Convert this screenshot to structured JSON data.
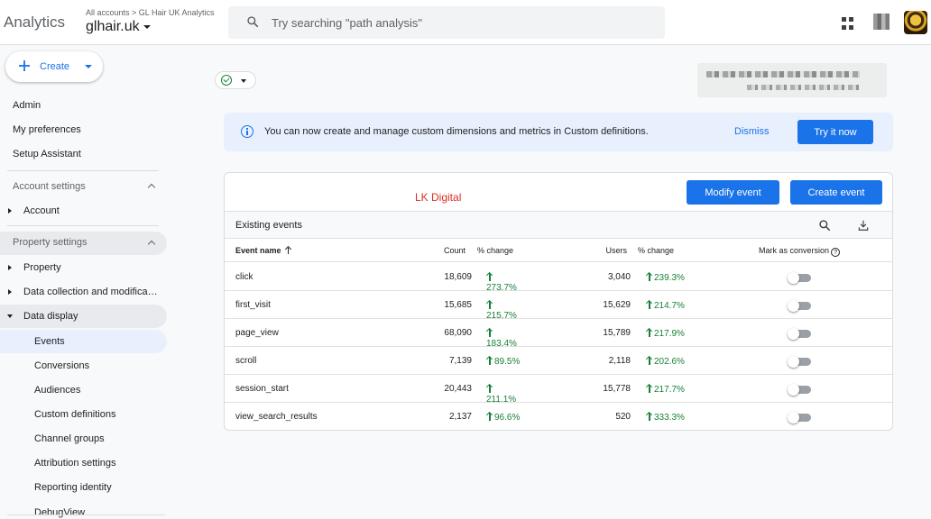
{
  "header": {
    "app_name": "Analytics",
    "breadcrumb": "All accounts > GL Hair UK Analytics",
    "property": "glhair.uk",
    "search_placeholder": "Try searching \"path analysis\""
  },
  "sidebar": {
    "create_label": "Create",
    "top_items": [
      "Admin",
      "My preferences",
      "Setup Assistant"
    ],
    "account_settings": {
      "title": "Account settings",
      "items": [
        "Account"
      ]
    },
    "property_settings": {
      "title": "Property settings",
      "items": [
        "Property",
        "Data collection and modifica…",
        "Data display"
      ],
      "data_display_items": [
        "Events",
        "Conversions",
        "Audiences",
        "Custom definitions",
        "Channel groups",
        "Attribution settings",
        "Reporting identity",
        "DebugView"
      ],
      "active_item": "Events"
    }
  },
  "banner": {
    "message": "You can now create and manage custom dimensions and metrics in Custom definitions.",
    "dismiss_label": "Dismiss",
    "try_label": "Try it now"
  },
  "events_card": {
    "org_label": "LK Digital",
    "modify_label": "Modify event",
    "create_label": "Create event",
    "title": "Existing events",
    "columns": {
      "event_name": "Event name",
      "count": "Count",
      "count_change": "% change",
      "users": "Users",
      "users_change": "% change",
      "conversion": "Mark as conversion"
    },
    "rows": [
      {
        "name": "click",
        "count": "18,609",
        "count_change": "273.7%",
        "users": "3,040",
        "users_change": "239.3%",
        "is_conversion": false
      },
      {
        "name": "first_visit",
        "count": "15,685",
        "count_change": "215.7%",
        "users": "15,629",
        "users_change": "214.7%",
        "is_conversion": false
      },
      {
        "name": "page_view",
        "count": "68,090",
        "count_change": "183.4%",
        "users": "15,789",
        "users_change": "217.9%",
        "is_conversion": false
      },
      {
        "name": "scroll",
        "count": "7,139",
        "count_change": "89.5%",
        "users": "2,118",
        "users_change": "202.6%",
        "is_conversion": false
      },
      {
        "name": "session_start",
        "count": "20,443",
        "count_change": "211.1%",
        "users": "15,778",
        "users_change": "217.7%",
        "is_conversion": false
      },
      {
        "name": "view_search_results",
        "count": "2,137",
        "count_change": "96.6%",
        "users": "520",
        "users_change": "333.3%",
        "is_conversion": false
      }
    ]
  },
  "colors": {
    "accent": "#1a73e8",
    "positive": "#188038",
    "org_label": "#d93025",
    "selected_bg": "#e8f0fe"
  }
}
